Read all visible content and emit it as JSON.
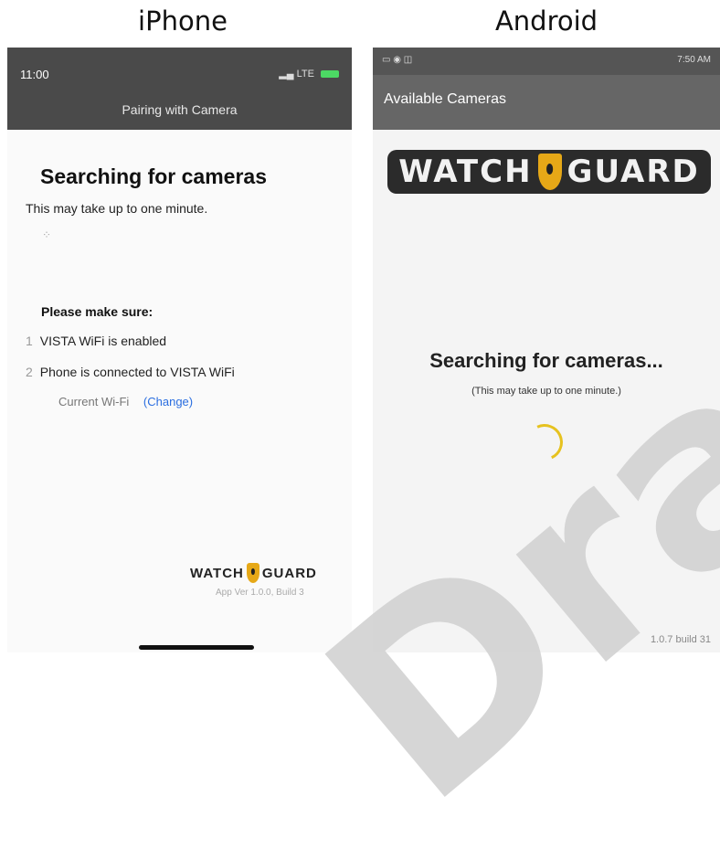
{
  "columns": {
    "iphone": "iPhone",
    "android": "Android"
  },
  "iphone": {
    "time": "11:00",
    "network": "LTE",
    "header_title": "Pairing with Camera",
    "search_title": "Searching for cameras",
    "subtitle": "This may take up to one minute.",
    "make_sure_title": "Please make sure:",
    "steps": [
      {
        "num": "1",
        "text": "VISTA WiFi is enabled"
      },
      {
        "num": "2",
        "text": "Phone is connected to VISTA WiFi"
      }
    ],
    "current_wifi_label": "Current Wi-Fi",
    "change_link": "(Change)",
    "logo_left": "WATCH",
    "logo_right": "GUARD",
    "version": "App Ver 1.0.0, Build 3"
  },
  "android": {
    "status_right": "7:50 AM",
    "title": "Available Cameras",
    "logo_left": "WATCH",
    "logo_right": "GUARD",
    "searching": "Searching for cameras...",
    "subtitle": "(This may take up to one minute.)",
    "version": "1.0.7 build 31"
  },
  "watermark": "Draft",
  "colors": {
    "header_dark": "#4a4a4a",
    "link_blue": "#2a6ee0",
    "shield_gold": "#e6a817",
    "spinner_yellow": "#e6c21f"
  }
}
